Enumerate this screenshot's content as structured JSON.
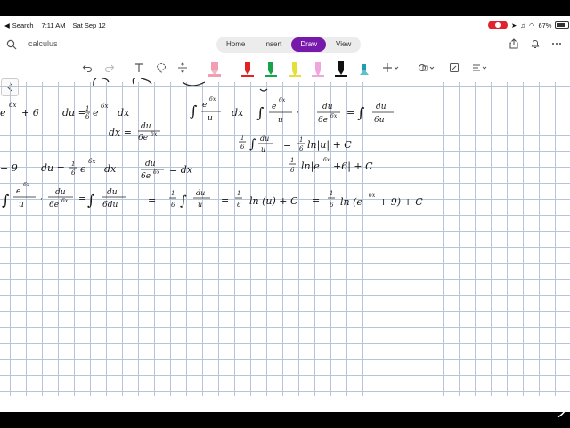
{
  "status": {
    "back": "Search",
    "time": "7:11 AM",
    "date": "Sat Sep 12",
    "battery": "67%"
  },
  "app": {
    "notebook_title": "calculus",
    "tabs": [
      "Home",
      "Insert",
      "Draw",
      "View"
    ],
    "active_tab": "Draw"
  },
  "toolbar": {
    "tools": [
      "undo-icon",
      "redo-icon",
      "text-icon",
      "lasso-icon",
      "space-icon",
      "pen-pink",
      "pen-red",
      "pen-green",
      "highlighter-yellow",
      "highlighter-pink",
      "pen-black",
      "pen-teal",
      "add-icon",
      "shapes-icon",
      "eraser-icon",
      "more-icon"
    ],
    "pen_colors": [
      "#f19db3",
      "#e02424",
      "#16a34a",
      "#e6df3a",
      "#f2a6e0",
      "#111111",
      "#1e9fae"
    ]
  },
  "handwriting": [
    "e^{6x} + 6",
    "du = (1/6) e^{6x} dx",
    "dx = du / 6e^{6x}",
    "∫ e^{6x}/u dx",
    "∫ e^{6x}/u · du/6e^{6x} = ∫ du/6u",
    "(1/6) ∫ du/u",
    "= (1/6) ln|u| + C",
    "(1/6) ln|e^{6x} + 6| + C",
    "+ 9",
    "du = (1/6) e^{6x} dx",
    "du/6e^{6x} = dx",
    "∫ e^{6x}/u · du/6e^{6x} = ∫ du/6du",
    "= (1/6) ∫ du/u = (1/6) ln(u) + C = (1/6) ln(e^{6x} + 9) + C"
  ]
}
